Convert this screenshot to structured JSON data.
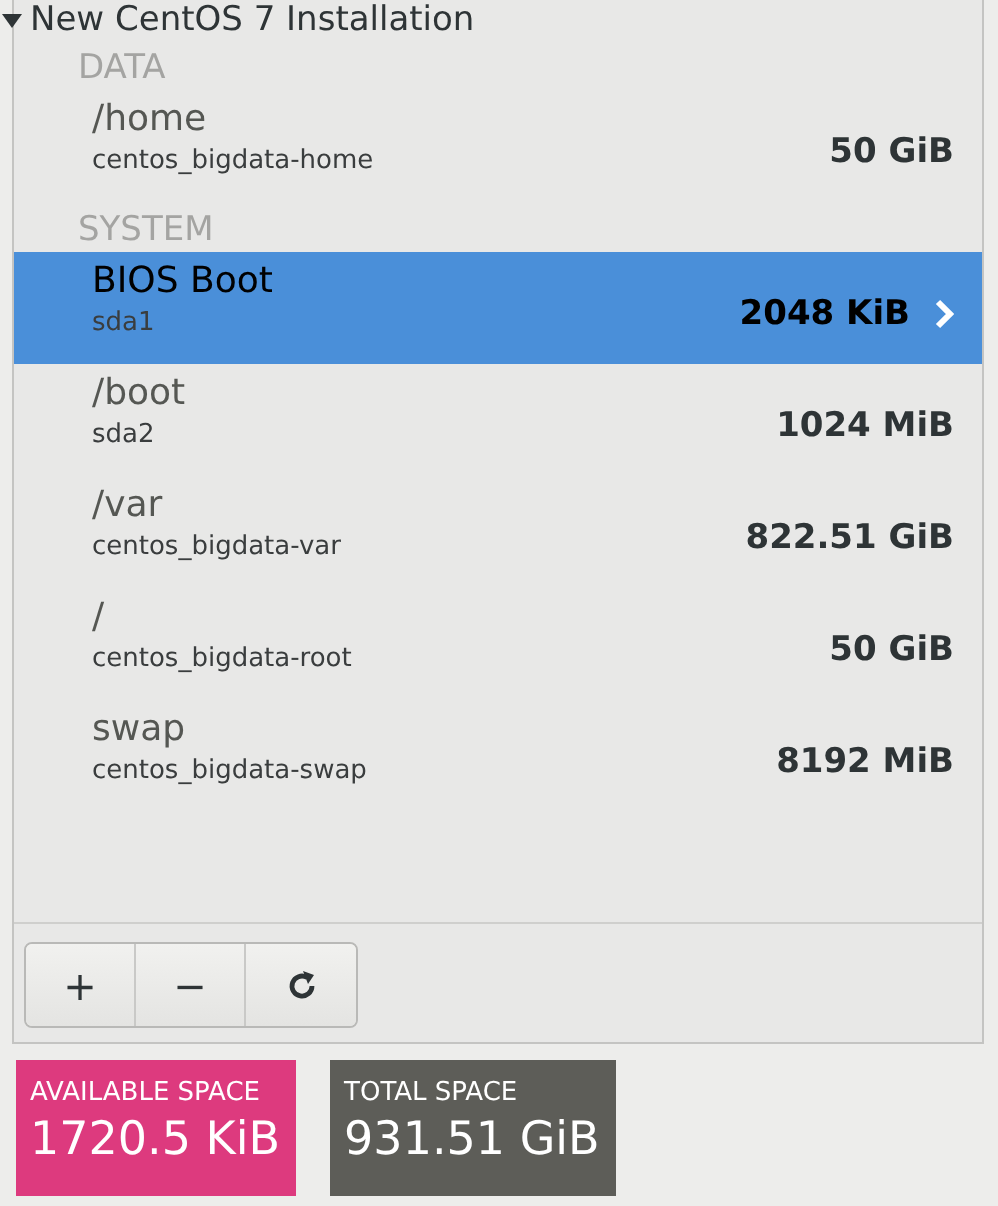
{
  "installation": {
    "title": "New CentOS 7 Installation",
    "expanded": true
  },
  "groups": [
    {
      "heading": "DATA",
      "mounts": [
        {
          "name": "/home",
          "device": "centos_bigdata-home",
          "size": "50 GiB",
          "selected": false
        }
      ]
    },
    {
      "heading": "SYSTEM",
      "mounts": [
        {
          "name": "BIOS Boot",
          "device": "sda1",
          "size": "2048 KiB",
          "selected": true
        },
        {
          "name": "/boot",
          "device": "sda2",
          "size": "1024 MiB",
          "selected": false
        },
        {
          "name": "/var",
          "device": "centos_bigdata-var",
          "size": "822.51 GiB",
          "selected": false
        },
        {
          "name": "/",
          "device": "centos_bigdata-root",
          "size": "50 GiB",
          "selected": false
        },
        {
          "name": "swap",
          "device": "centos_bigdata-swap",
          "size": "8192 MiB",
          "selected": false
        }
      ]
    }
  ],
  "toolbar": [
    {
      "kind": "add",
      "label": "+"
    },
    {
      "kind": "remove",
      "label": "−"
    },
    {
      "kind": "reset"
    }
  ],
  "space": [
    {
      "label": "AVAILABLE SPACE",
      "value": "1720.5 KiB",
      "color": "#dd3a7e"
    },
    {
      "label": "TOTAL SPACE",
      "value": "931.51 GiB",
      "color": "#5d5d58"
    }
  ]
}
